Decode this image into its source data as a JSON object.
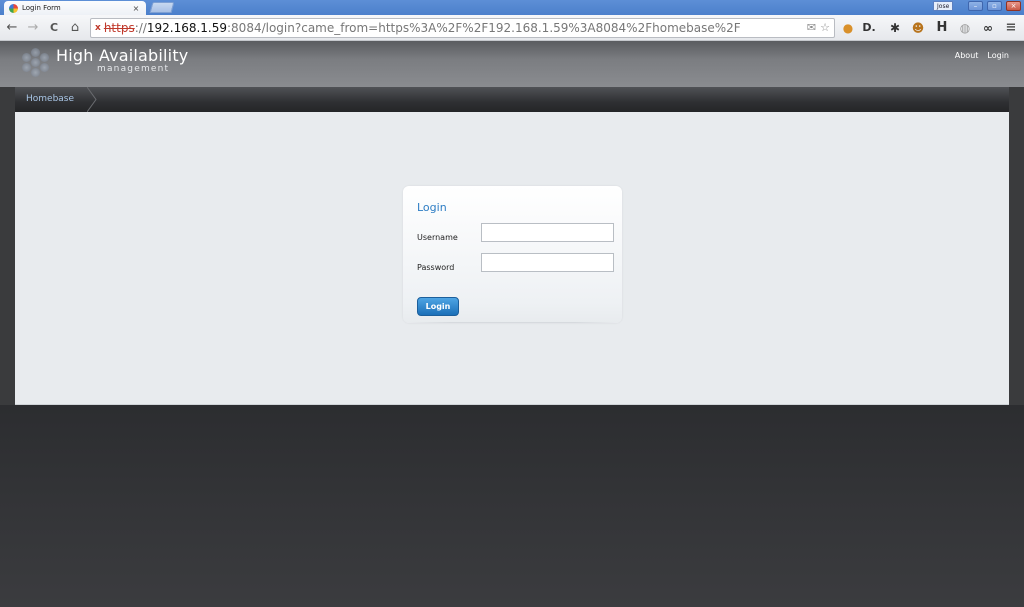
{
  "browser": {
    "tab_title": "Login Form",
    "tab_close": "×",
    "user_badge": "Jose",
    "window_controls": [
      "–",
      "▫",
      "×"
    ],
    "nav": {
      "back": "←",
      "forward": "→",
      "reload": "C",
      "home": "⌂"
    },
    "url": {
      "insecure_marker": "x",
      "scheme": "https",
      "sep": "://",
      "host": "192.168.1.59",
      "rest": ":8084/login?came_from=https%3A%2F%2F192.168.1.59%3A8084%2Fhomebase%2F"
    },
    "omnibox_icons": [
      "mail-icon",
      "star-icon"
    ],
    "extensions": [
      {
        "name": "cookie-extension-icon",
        "glyph": "●"
      },
      {
        "name": "d-extension-icon",
        "glyph": "D."
      },
      {
        "name": "bug-extension-icon",
        "glyph": "✱"
      },
      {
        "name": "ghostery-extension-icon",
        "glyph": "☻"
      },
      {
        "name": "h-extension-icon",
        "glyph": "H"
      },
      {
        "name": "globe-extension-icon",
        "glyph": "◍"
      },
      {
        "name": "mask-extension-icon",
        "glyph": "∞"
      },
      {
        "name": "menu-icon",
        "glyph": "≡"
      }
    ]
  },
  "app": {
    "logo_title": "High Availability",
    "logo_sub": "management",
    "top_links": {
      "about": "About",
      "login": "Login"
    },
    "breadcrumb": "Homebase"
  },
  "login": {
    "heading": "Login",
    "username_label": "Username",
    "username_value": "",
    "password_label": "Password",
    "password_value": "",
    "submit_label": "Login"
  },
  "colors": {
    "accent": "#2d7dc4",
    "button": "#1b6fb8",
    "insecure": "#c0392b"
  }
}
